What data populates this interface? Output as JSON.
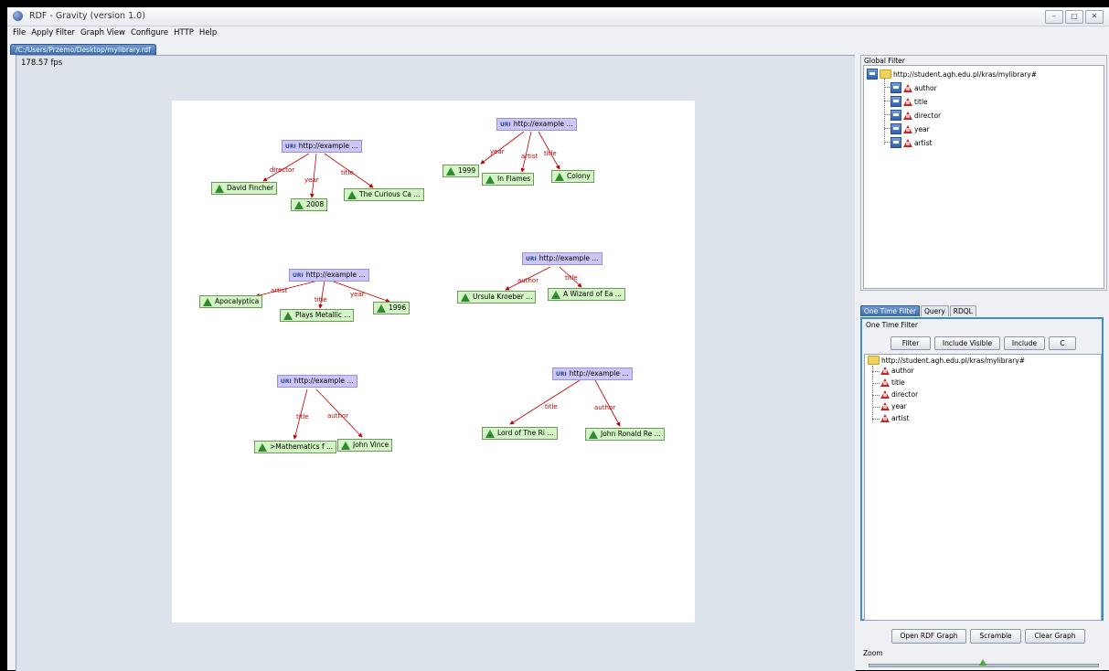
{
  "window": {
    "title": "RDF - Gravity (version 1.0)",
    "minimize": "–",
    "maximize": "□",
    "close": "✕"
  },
  "menu": [
    "File",
    "Apply Filter",
    "Graph View",
    "Configure",
    "HTTP",
    "Help"
  ],
  "file_tab": "/C:/Users/Przemo/Desktop/mylibrary.rdf",
  "graph": {
    "fps": "178.57 fps",
    "uri_label": "http://example ...",
    "uri_glyph": "URI",
    "clusters": [
      {
        "literals": [
          "David Fincher",
          "2008",
          "The Curious Ca ..."
        ],
        "edges": [
          "director",
          "year",
          "title"
        ]
      },
      {
        "literals": [
          "1999",
          "In Flames",
          "Colony"
        ],
        "edges": [
          "year",
          "artist",
          "title"
        ]
      },
      {
        "literals": [
          "Apocalyptica",
          "Plays Metallic ...",
          "1996"
        ],
        "edges": [
          "artist",
          "title",
          "year"
        ]
      },
      {
        "literals": [
          "Ursula Kroeber ...",
          "A Wizard of Ea ..."
        ],
        "edges": [
          "author",
          "title"
        ]
      },
      {
        "literals": [
          ">Mathematics f ...",
          "John Vince"
        ],
        "edges": [
          "title",
          "author"
        ]
      },
      {
        "literals": [
          "Lord of The Ri ...",
          "John Ronald Re ..."
        ],
        "edges": [
          "title",
          "author"
        ]
      }
    ]
  },
  "global_filter": {
    "title": "Global Filter",
    "root": "http://student.agh.edu.pl/kras/mylibrary#",
    "items": [
      "author",
      "title",
      "director",
      "year",
      "artist"
    ]
  },
  "tabs": [
    "One Time Filter",
    "Query",
    "RDQL"
  ],
  "one_time_filter": {
    "title": "One Time Filter",
    "buttons": [
      "Filter",
      "Include Visible",
      "Include",
      "C"
    ],
    "root": "http://student.agh.edu.pl/kras/mylibrary#",
    "items": [
      "author",
      "title",
      "director",
      "year",
      "artist"
    ]
  },
  "bottom_buttons": [
    "Open RDF Graph",
    "Scramble",
    "Clear Graph"
  ],
  "zoom": {
    "label": "Zoom",
    "level": 0.5
  },
  "colors": {
    "uri_node": "#ccc6f5",
    "literal_node": "#d3f4c4",
    "edge": "#c00000",
    "accent": "#3d8fc0"
  }
}
